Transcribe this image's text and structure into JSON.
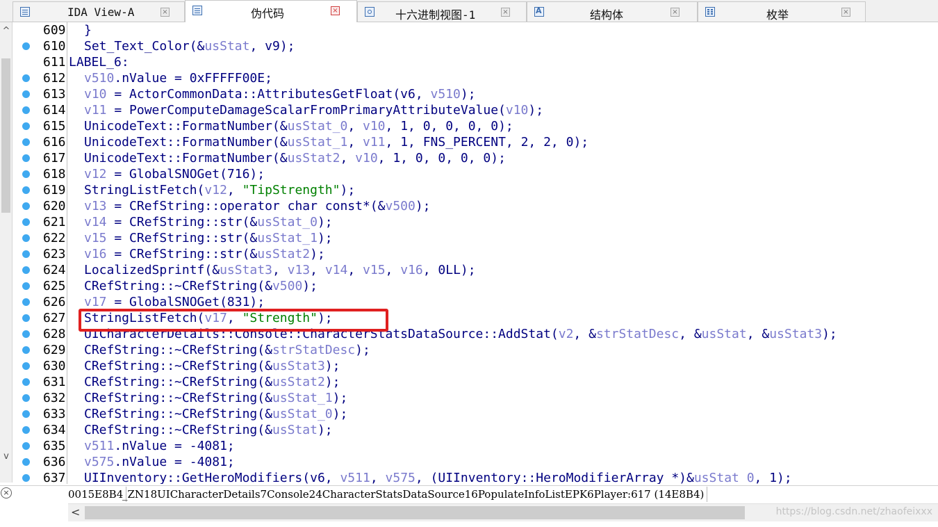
{
  "tabs": [
    {
      "label": "IDA View-A",
      "active": false,
      "icon": "doc-icon"
    },
    {
      "label": "伪代码",
      "active": true,
      "icon": "doc-icon"
    },
    {
      "label": "十六进制视图-1",
      "active": false,
      "icon": "hex-icon"
    },
    {
      "label": "结构体",
      "active": false,
      "icon": "struct-icon"
    },
    {
      "label": "枚举",
      "active": false,
      "icon": "enum-icon"
    }
  ],
  "tab_close_glyph": "×",
  "code_lines": [
    {
      "num": "609",
      "bp": false,
      "indent": true,
      "tokens": [
        [
          "}",
          "punc"
        ]
      ]
    },
    {
      "num": "610",
      "bp": true,
      "indent": true,
      "tokens": [
        [
          "Set_Text_Color",
          "id"
        ],
        [
          "(&",
          "punc"
        ],
        [
          "usStat",
          "var"
        ],
        [
          ", ",
          "punc"
        ],
        [
          "v9",
          "id"
        ],
        [
          ");",
          "punc"
        ]
      ]
    },
    {
      "num": "611",
      "bp": false,
      "indent": false,
      "tokens": [
        [
          "LABEL_6:",
          "lbl"
        ]
      ]
    },
    {
      "num": "612",
      "bp": true,
      "indent": true,
      "tokens": [
        [
          "v510",
          "var"
        ],
        [
          ".nValue = 0xFFFFF00E;",
          "id"
        ]
      ]
    },
    {
      "num": "613",
      "bp": true,
      "indent": true,
      "tokens": [
        [
          "v10",
          "var"
        ],
        [
          " = ActorCommonData::AttributesGetFloat(v6, ",
          "id"
        ],
        [
          "v510",
          "var"
        ],
        [
          ");",
          "punc"
        ]
      ]
    },
    {
      "num": "614",
      "bp": true,
      "indent": true,
      "tokens": [
        [
          "v11",
          "var"
        ],
        [
          " = PowerComputeDamageScalarFromPrimaryAttributeValue(",
          "id"
        ],
        [
          "v10",
          "var"
        ],
        [
          ");",
          "punc"
        ]
      ]
    },
    {
      "num": "615",
      "bp": true,
      "indent": true,
      "tokens": [
        [
          "UnicodeText::FormatNumber(&",
          "id"
        ],
        [
          "usStat_0",
          "var"
        ],
        [
          ", ",
          "punc"
        ],
        [
          "v10",
          "var"
        ],
        [
          ", 1, 0, 0, 0, 0);",
          "id"
        ]
      ]
    },
    {
      "num": "616",
      "bp": true,
      "indent": true,
      "tokens": [
        [
          "UnicodeText::FormatNumber(&",
          "id"
        ],
        [
          "usStat_1",
          "var"
        ],
        [
          ", ",
          "punc"
        ],
        [
          "v11",
          "var"
        ],
        [
          ", 1, FNS_PERCENT, 2, 2, 0);",
          "id"
        ]
      ]
    },
    {
      "num": "617",
      "bp": true,
      "indent": true,
      "tokens": [
        [
          "UnicodeText::FormatNumber(&",
          "id"
        ],
        [
          "usStat2",
          "var"
        ],
        [
          ", ",
          "punc"
        ],
        [
          "v10",
          "var"
        ],
        [
          ", 1, 0, 0, 0, 0);",
          "id"
        ]
      ]
    },
    {
      "num": "618",
      "bp": true,
      "indent": true,
      "tokens": [
        [
          "v12",
          "var"
        ],
        [
          " = GlobalSNOGet(716);",
          "id"
        ]
      ]
    },
    {
      "num": "619",
      "bp": true,
      "indent": true,
      "tokens": [
        [
          "StringListFetch(",
          "id"
        ],
        [
          "v12",
          "var"
        ],
        [
          ", ",
          "punc"
        ],
        [
          "\"TipStrength\"",
          "str"
        ],
        [
          ");",
          "punc"
        ]
      ]
    },
    {
      "num": "620",
      "bp": true,
      "indent": true,
      "tokens": [
        [
          "v13",
          "var"
        ],
        [
          " = CRefString::operator char const*(&",
          "id"
        ],
        [
          "v500",
          "var"
        ],
        [
          ");",
          "punc"
        ]
      ]
    },
    {
      "num": "621",
      "bp": true,
      "indent": true,
      "tokens": [
        [
          "v14",
          "var"
        ],
        [
          " = CRefString::str(&",
          "id"
        ],
        [
          "usStat_0",
          "var"
        ],
        [
          ");",
          "punc"
        ]
      ]
    },
    {
      "num": "622",
      "bp": true,
      "indent": true,
      "tokens": [
        [
          "v15",
          "var"
        ],
        [
          " = CRefString::str(&",
          "id"
        ],
        [
          "usStat_1",
          "var"
        ],
        [
          ");",
          "punc"
        ]
      ]
    },
    {
      "num": "623",
      "bp": true,
      "indent": true,
      "tokens": [
        [
          "v16",
          "var"
        ],
        [
          " = CRefString::str(&",
          "id"
        ],
        [
          "usStat2",
          "var"
        ],
        [
          ");",
          "punc"
        ]
      ]
    },
    {
      "num": "624",
      "bp": true,
      "indent": true,
      "tokens": [
        [
          "LocalizedSprintf(&",
          "id"
        ],
        [
          "usStat3",
          "var"
        ],
        [
          ", ",
          "punc"
        ],
        [
          "v13",
          "var"
        ],
        [
          ", ",
          "punc"
        ],
        [
          "v14",
          "var"
        ],
        [
          ", ",
          "punc"
        ],
        [
          "v15",
          "var"
        ],
        [
          ", ",
          "punc"
        ],
        [
          "v16",
          "var"
        ],
        [
          ", 0LL);",
          "id"
        ]
      ]
    },
    {
      "num": "625",
      "bp": true,
      "indent": true,
      "tokens": [
        [
          "CRefString::~CRefString(&",
          "id"
        ],
        [
          "v500",
          "var"
        ],
        [
          ");",
          "punc"
        ]
      ]
    },
    {
      "num": "626",
      "bp": true,
      "indent": true,
      "tokens": [
        [
          "v17",
          "var"
        ],
        [
          " = GlobalSNOGet(831);",
          "id"
        ]
      ]
    },
    {
      "num": "627",
      "bp": true,
      "indent": true,
      "tokens": [
        [
          "StringListFetch(",
          "id"
        ],
        [
          "v17",
          "var"
        ],
        [
          ", ",
          "punc"
        ],
        [
          "\"Strength\"",
          "str"
        ],
        [
          ");",
          "punc"
        ]
      ]
    },
    {
      "num": "628",
      "bp": true,
      "indent": true,
      "tokens": [
        [
          "UICharacterDetails::Console::CharacterStatsDataSource::AddStat(",
          "id"
        ],
        [
          "v2",
          "var"
        ],
        [
          ", &",
          "punc"
        ],
        [
          "strStatDesc",
          "var"
        ],
        [
          ", &",
          "punc"
        ],
        [
          "usStat",
          "var"
        ],
        [
          ", &",
          "punc"
        ],
        [
          "usStat3",
          "var"
        ],
        [
          ");",
          "punc"
        ]
      ]
    },
    {
      "num": "629",
      "bp": true,
      "indent": true,
      "tokens": [
        [
          "CRefString::~CRefString(&",
          "id"
        ],
        [
          "strStatDesc",
          "var"
        ],
        [
          ");",
          "punc"
        ]
      ]
    },
    {
      "num": "630",
      "bp": true,
      "indent": true,
      "tokens": [
        [
          "CRefString::~CRefString(&",
          "id"
        ],
        [
          "usStat3",
          "var"
        ],
        [
          ");",
          "punc"
        ]
      ]
    },
    {
      "num": "631",
      "bp": true,
      "indent": true,
      "tokens": [
        [
          "CRefString::~CRefString(&",
          "id"
        ],
        [
          "usStat2",
          "var"
        ],
        [
          ");",
          "punc"
        ]
      ]
    },
    {
      "num": "632",
      "bp": true,
      "indent": true,
      "tokens": [
        [
          "CRefString::~CRefString(&",
          "id"
        ],
        [
          "usStat_1",
          "var"
        ],
        [
          ");",
          "punc"
        ]
      ]
    },
    {
      "num": "633",
      "bp": true,
      "indent": true,
      "tokens": [
        [
          "CRefString::~CRefString(&",
          "id"
        ],
        [
          "usStat_0",
          "var"
        ],
        [
          ");",
          "punc"
        ]
      ]
    },
    {
      "num": "634",
      "bp": true,
      "indent": true,
      "tokens": [
        [
          "CRefString::~CRefString(&",
          "id"
        ],
        [
          "usStat",
          "var"
        ],
        [
          ");",
          "punc"
        ]
      ]
    },
    {
      "num": "635",
      "bp": true,
      "indent": true,
      "tokens": [
        [
          "v511",
          "var"
        ],
        [
          ".nValue = -4081;",
          "id"
        ]
      ]
    },
    {
      "num": "636",
      "bp": true,
      "indent": true,
      "tokens": [
        [
          "v575",
          "var"
        ],
        [
          ".nValue = -4081;",
          "id"
        ]
      ]
    },
    {
      "num": "637",
      "bp": true,
      "indent": true,
      "tokens": [
        [
          "UIInventory::GetHeroModifiers(v6, ",
          "id"
        ],
        [
          "v511",
          "var"
        ],
        [
          ", ",
          "punc"
        ],
        [
          "v575",
          "var"
        ],
        [
          ", (UIInventory::HeroModifierArray *)&",
          "id"
        ],
        [
          "usStat_0",
          "var"
        ],
        [
          ", 1);",
          "id"
        ]
      ]
    }
  ],
  "highlighted_line": "627",
  "status": {
    "address": "0015E8B4",
    "function": "_ZN18UICharacterDetails7Console24CharacterStatsDataSource16PopulateInfoListEPK6Player:617 (14E8B4)"
  },
  "scrollbar": {
    "up_glyph": "^",
    "down_glyph": "v",
    "left_glyph": "<"
  },
  "status_close_glyph": "×",
  "watermark": "https://blog.csdn.net/zhaofeixxx",
  "colors": {
    "breakpoint": "#3fa9f0",
    "identifier": "#000080",
    "variable": "#7a7acd",
    "string": "#008000",
    "highlight_box": "#e02020"
  }
}
